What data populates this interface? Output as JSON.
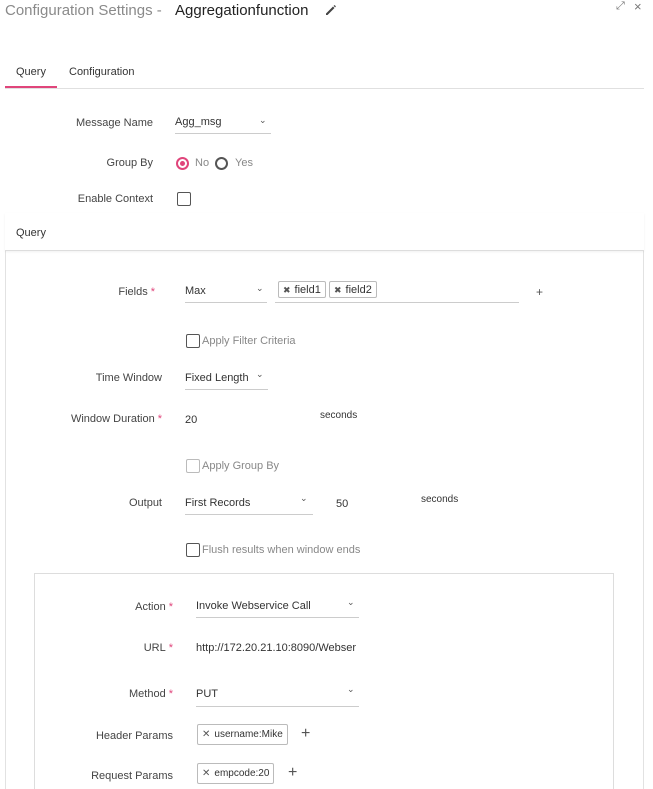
{
  "header": {
    "title_prefix": "Configuration Settings -",
    "title_name": "Aggregationfunction"
  },
  "window_controls": {
    "expand": "⤢",
    "close": "×"
  },
  "tabs": [
    {
      "label": "Query",
      "active": true
    },
    {
      "label": "Configuration",
      "active": false
    }
  ],
  "form": {
    "message_name_label": "Message Name",
    "message_name_value": "Agg_msg",
    "group_by_label": "Group By",
    "group_by_options": [
      "No",
      "Yes"
    ],
    "group_by_selected": "No",
    "enable_context_label": "Enable Context"
  },
  "query_panel": {
    "title": "Query",
    "fields_label": "Fields",
    "fields_function": "Max",
    "fields_tags": [
      "field1",
      "field2"
    ],
    "apply_filter_label": "Apply Filter Criteria",
    "time_window_label": "Time Window",
    "time_window_value": "Fixed Length",
    "window_duration_label": "Window Duration",
    "window_duration_value": "20",
    "window_duration_unit": "seconds",
    "apply_group_by_label": "Apply Group By",
    "output_label": "Output",
    "output_value": "First Records",
    "output_number": "50",
    "output_unit": "seconds",
    "flush_label": "Flush results when window ends"
  },
  "action_panel": {
    "action_label": "Action",
    "action_value": "Invoke Webservice Call",
    "url_label": "URL",
    "url_value": "http://172.20.21.10:8090/Webser",
    "method_label": "Method",
    "method_value": "PUT",
    "header_params_label": "Header Params",
    "header_params_tags": [
      "username:Mike"
    ],
    "request_params_label": "Request Params",
    "request_params_tags": [
      "empcode:20"
    ]
  },
  "colors": {
    "accent": "#e0457b"
  }
}
